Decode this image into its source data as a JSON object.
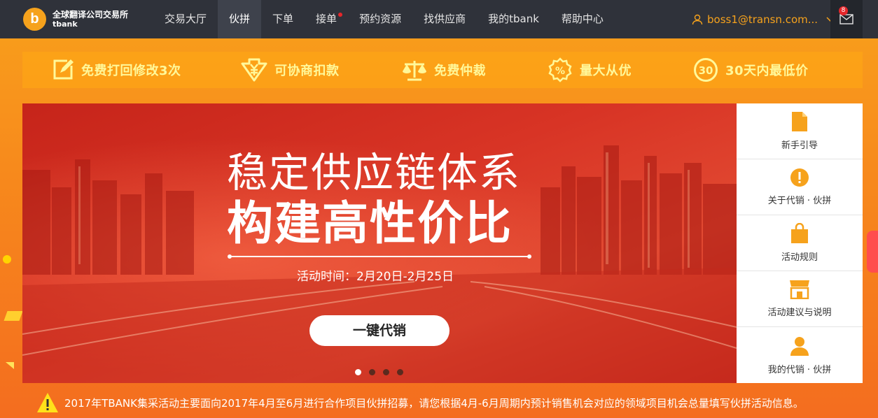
{
  "logo": {
    "mark": "b",
    "name_cn": "全球翻译公司交易所",
    "name_en": "tbank"
  },
  "nav": {
    "items": [
      {
        "label": "交易大厅",
        "active": false
      },
      {
        "label": "伙拼",
        "active": true
      },
      {
        "label": "下单",
        "active": false
      },
      {
        "label": "接单",
        "active": false,
        "dot": true
      },
      {
        "label": "预约资源",
        "active": false
      },
      {
        "label": "找供应商",
        "active": false
      },
      {
        "label": "我的tbank",
        "active": false
      },
      {
        "label": "帮助中心",
        "active": false
      }
    ],
    "user": "boss1@transn.com...",
    "mail_count": "8"
  },
  "features": [
    {
      "icon": "edit-icon",
      "label": "免费打回修改3次"
    },
    {
      "icon": "yen-download-icon",
      "label": "可协商扣款"
    },
    {
      "icon": "scale-icon",
      "label": "免费仲裁"
    },
    {
      "icon": "percent-badge-icon",
      "label": "量大从优"
    },
    {
      "icon": "thirty-circle-icon",
      "label": "30天内最低价",
      "icon_text": "30"
    }
  ],
  "banner": {
    "title1": "稳定供应链体系",
    "title2": "构建高性价比",
    "time": "活动时间：2月20日-2月25日",
    "button": "一键代销",
    "slide_count": 4,
    "active_slide": 0
  },
  "side_menu": [
    {
      "icon": "document-icon",
      "label": "新手引导"
    },
    {
      "icon": "exclamation-circle-icon",
      "label": "关于代销 · 伙拼"
    },
    {
      "icon": "shopping-bag-icon",
      "label": "活动规则"
    },
    {
      "icon": "storefront-icon",
      "label": "活动建议与说明"
    },
    {
      "icon": "user-icon",
      "label": "我的代销 · 伙拼"
    }
  ],
  "notice": "2017年TBANK集采活动主要面向2017年4月至6月进行合作项目伙拼招募，请您根据4月-6月周期内预计销售机会对应的领域项目机会总量填写伙拼活动信息。",
  "colors": {
    "accent": "#f6a21c",
    "nav_bg": "#2f323a",
    "feature_text": "#fff89a"
  }
}
